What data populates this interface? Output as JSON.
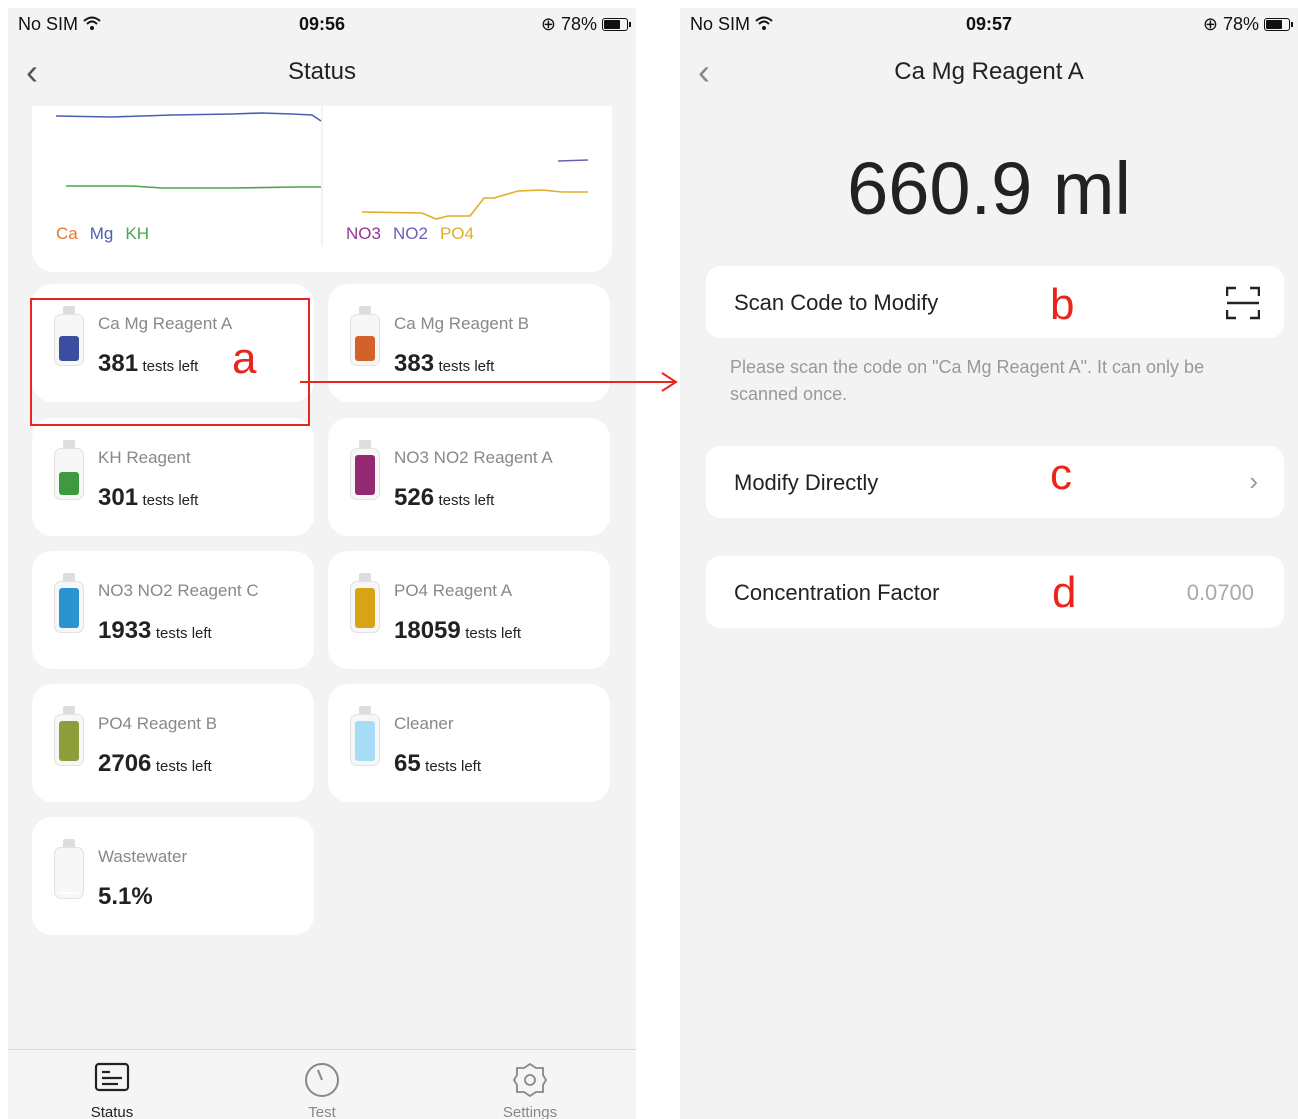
{
  "left_screen": {
    "status_bar": {
      "carrier": "No SIM",
      "time": "09:56",
      "battery": "78%"
    },
    "nav": {
      "back": "‹",
      "title": "Status"
    },
    "chart_legend_left": [
      {
        "label": "Ca",
        "color": "#e8742a"
      },
      {
        "label": "Mg",
        "color": "#4a5fb0"
      },
      {
        "label": "KH",
        "color": "#4aa64a"
      }
    ],
    "chart_legend_right": [
      {
        "label": "NO3",
        "color": "#8e3a8e"
      },
      {
        "label": "NO2",
        "color": "#6a5fb5"
      },
      {
        "label": "PO4",
        "color": "#e0ad26"
      }
    ],
    "reagents": [
      {
        "name": "Ca Mg Reagent A",
        "count": "381",
        "unit": "tests left",
        "color": "#3a4fa0",
        "level": 0.6
      },
      {
        "name": "Ca Mg Reagent B",
        "count": "383",
        "unit": "tests left",
        "color": "#d3612a",
        "level": 0.6
      },
      {
        "name": "KH Reagent",
        "count": "301",
        "unit": "tests left",
        "color": "#3f9a3f",
        "level": 0.55
      },
      {
        "name": "NO3 NO2 Reagent A",
        "count": "526",
        "unit": "tests left",
        "color": "#932a72",
        "level": 0.95
      },
      {
        "name": "NO3 NO2 Reagent C",
        "count": "1933",
        "unit": "tests left",
        "color": "#2a94d0",
        "level": 0.95
      },
      {
        "name": "PO4 Reagent A",
        "count": "18059",
        "unit": "tests left",
        "color": "#d9a317",
        "level": 0.95
      },
      {
        "name": "PO4 Reagent B",
        "count": "2706",
        "unit": "tests left",
        "color": "#8e9e3a",
        "level": 0.95
      },
      {
        "name": "Cleaner",
        "count": "65",
        "unit": "tests left",
        "color": "#a6dcf5",
        "level": 0.95
      },
      {
        "name": "Wastewater",
        "count": "5.1%",
        "unit": "",
        "color": "#ffffff",
        "level": 0.05
      }
    ],
    "tabs": [
      {
        "label": "Status",
        "icon": "status-icon",
        "active": true
      },
      {
        "label": "Test",
        "icon": "timer-icon",
        "active": false
      },
      {
        "label": "Settings",
        "icon": "gear-icon",
        "active": false
      }
    ]
  },
  "right_screen": {
    "status_bar": {
      "carrier": "No SIM",
      "time": "09:57",
      "battery": "78%"
    },
    "nav": {
      "back": "‹",
      "title": "Ca Mg Reagent A"
    },
    "volume": "660.9 ml",
    "scan_row": {
      "label": "Scan Code to Modify",
      "icon": "scan-icon"
    },
    "hint": "Please scan the code on \"Ca Mg Reagent A\". It can only be scanned once.",
    "modify_row": {
      "label": "Modify Directly",
      "icon": "chevron-right-icon"
    },
    "factor_row": {
      "label": "Concentration Factor",
      "value": "0.0700"
    }
  },
  "annotations": {
    "a": "a",
    "b": "b",
    "c": "c",
    "d": "d"
  }
}
